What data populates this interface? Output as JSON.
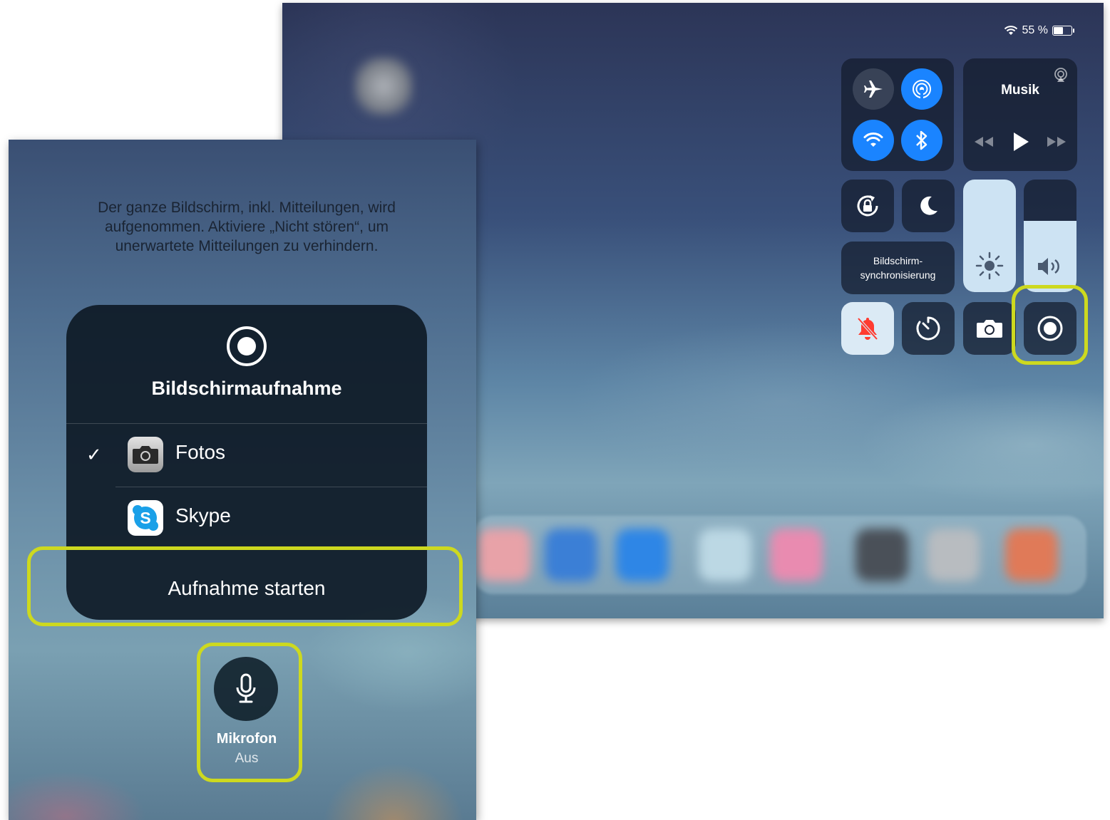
{
  "status_bar": {
    "battery_text": "55 %"
  },
  "control_center": {
    "music": {
      "title": "Musik"
    },
    "screen_mirroring_label_line1": "Bildschirm-",
    "screen_mirroring_label_line2": "synchronisierung",
    "icons": [
      "airplane-icon",
      "airdrop-icon",
      "wifi-icon",
      "bluetooth-icon",
      "rotation-lock-icon",
      "moon-icon",
      "brightness-icon",
      "volume-icon",
      "bell-mute-icon",
      "timer-icon",
      "camera-icon",
      "screen-record-icon",
      "airplay-icon",
      "rewind-icon",
      "play-icon",
      "fast-forward-icon"
    ],
    "brightness_level": 1.0,
    "volume_level": 0.63
  },
  "record_sheet": {
    "info_text": "Der ganze Bildschirm, inkl. Mitteilungen, wird aufgenommen. Aktiviere „Nicht stören“, um unerwartete Mitteilungen zu verhindern.",
    "title": "Bildschirmaufnahme",
    "destinations": [
      {
        "label": "Fotos",
        "selected": true,
        "icon": "camera-app-icon"
      },
      {
        "label": "Skype",
        "selected": false,
        "icon": "skype-app-icon"
      }
    ],
    "checkmark": "✓",
    "start_button": "Aufnahme starten",
    "microphone": {
      "title": "Mikrofon",
      "state": "Aus"
    }
  },
  "colors": {
    "highlight": "#cdd91f",
    "active_blue": "#1a84ff",
    "mute_red": "#ff3b30"
  }
}
